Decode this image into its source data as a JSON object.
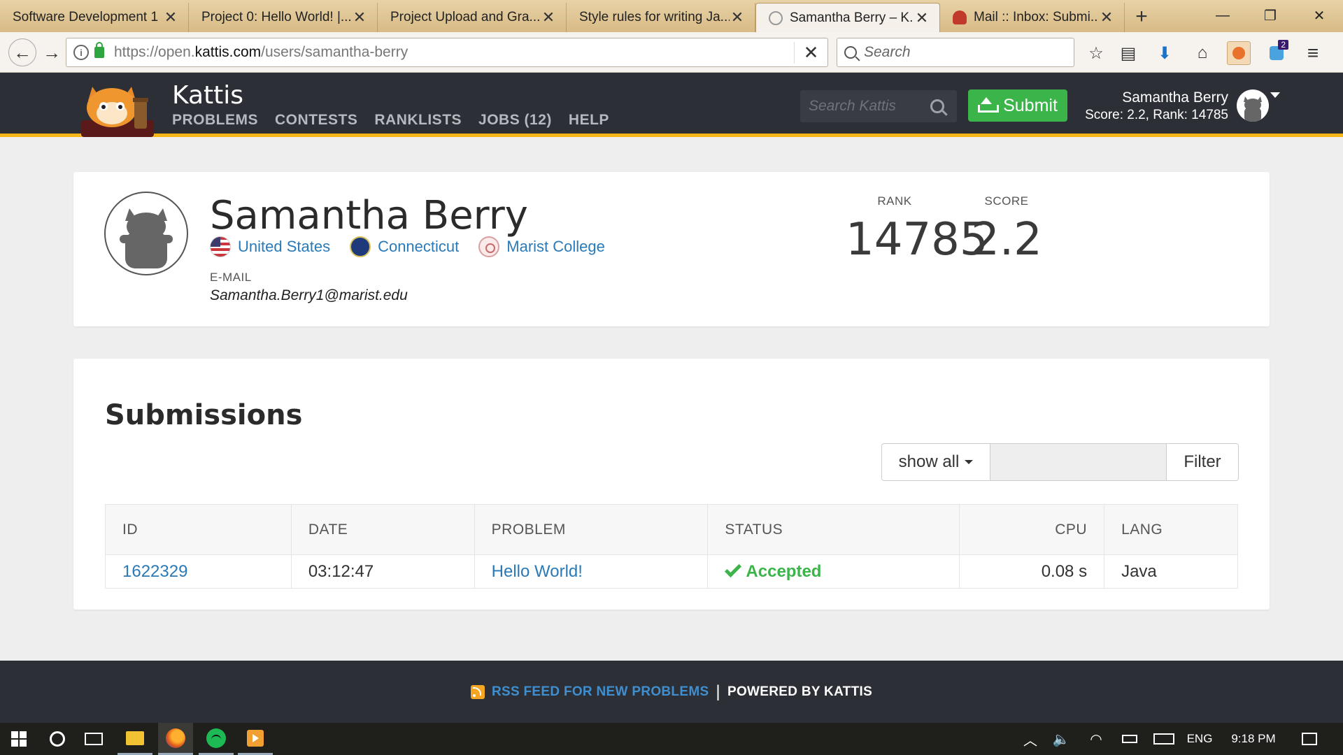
{
  "browser": {
    "tabs": [
      {
        "title": "Software Development 1",
        "active": false
      },
      {
        "title": "Project 0: Hello World! |...",
        "active": false
      },
      {
        "title": "Project Upload and Gra...",
        "active": false
      },
      {
        "title": "Style rules for writing Ja...",
        "active": false
      },
      {
        "title": "Samantha Berry – K...",
        "active": true
      },
      {
        "title": "Mail :: Inbox: Submi...",
        "active": false
      }
    ],
    "url_prefix": "https://open.",
    "url_domain": "kattis.com",
    "url_path": "/users/samantha-berry",
    "search_placeholder": "Search",
    "notification_count": "2"
  },
  "site": {
    "brand": "Kattis",
    "nav": [
      "PROBLEMS",
      "CONTESTS",
      "RANKLISTS",
      "JOBS (12)",
      "HELP"
    ],
    "search_placeholder": "Search Kattis",
    "submit_label": "Submit",
    "user_name": "Samantha Berry",
    "user_stats": "Score: 2.2, Rank: 14785",
    "accent_color": "#f5b61a",
    "submit_color": "#3bb54a"
  },
  "profile": {
    "name": "Samantha Berry",
    "country": "United States",
    "region": "Connecticut",
    "school": "Marist College",
    "email_label": "E-MAIL",
    "email": "Samantha.Berry1@marist.edu",
    "rank_label": "RANK",
    "rank": "14785",
    "score_label": "SCORE",
    "score": "2.2"
  },
  "submissions": {
    "title": "Submissions",
    "filter_select": "show all",
    "filter_button": "Filter",
    "columns": [
      "ID",
      "DATE",
      "PROBLEM",
      "STATUS",
      "CPU",
      "LANG"
    ],
    "rows": [
      {
        "id": "1622329",
        "date": "03:12:47",
        "problem": "Hello World!",
        "status": "Accepted",
        "cpu": "0.08 s",
        "lang": "Java"
      }
    ]
  },
  "footer": {
    "rss": "RSS FEED FOR NEW PROBLEMS",
    "separator": "|",
    "powered": "POWERED BY KATTIS"
  },
  "taskbar": {
    "language": "ENG",
    "time": "9:18 PM"
  }
}
